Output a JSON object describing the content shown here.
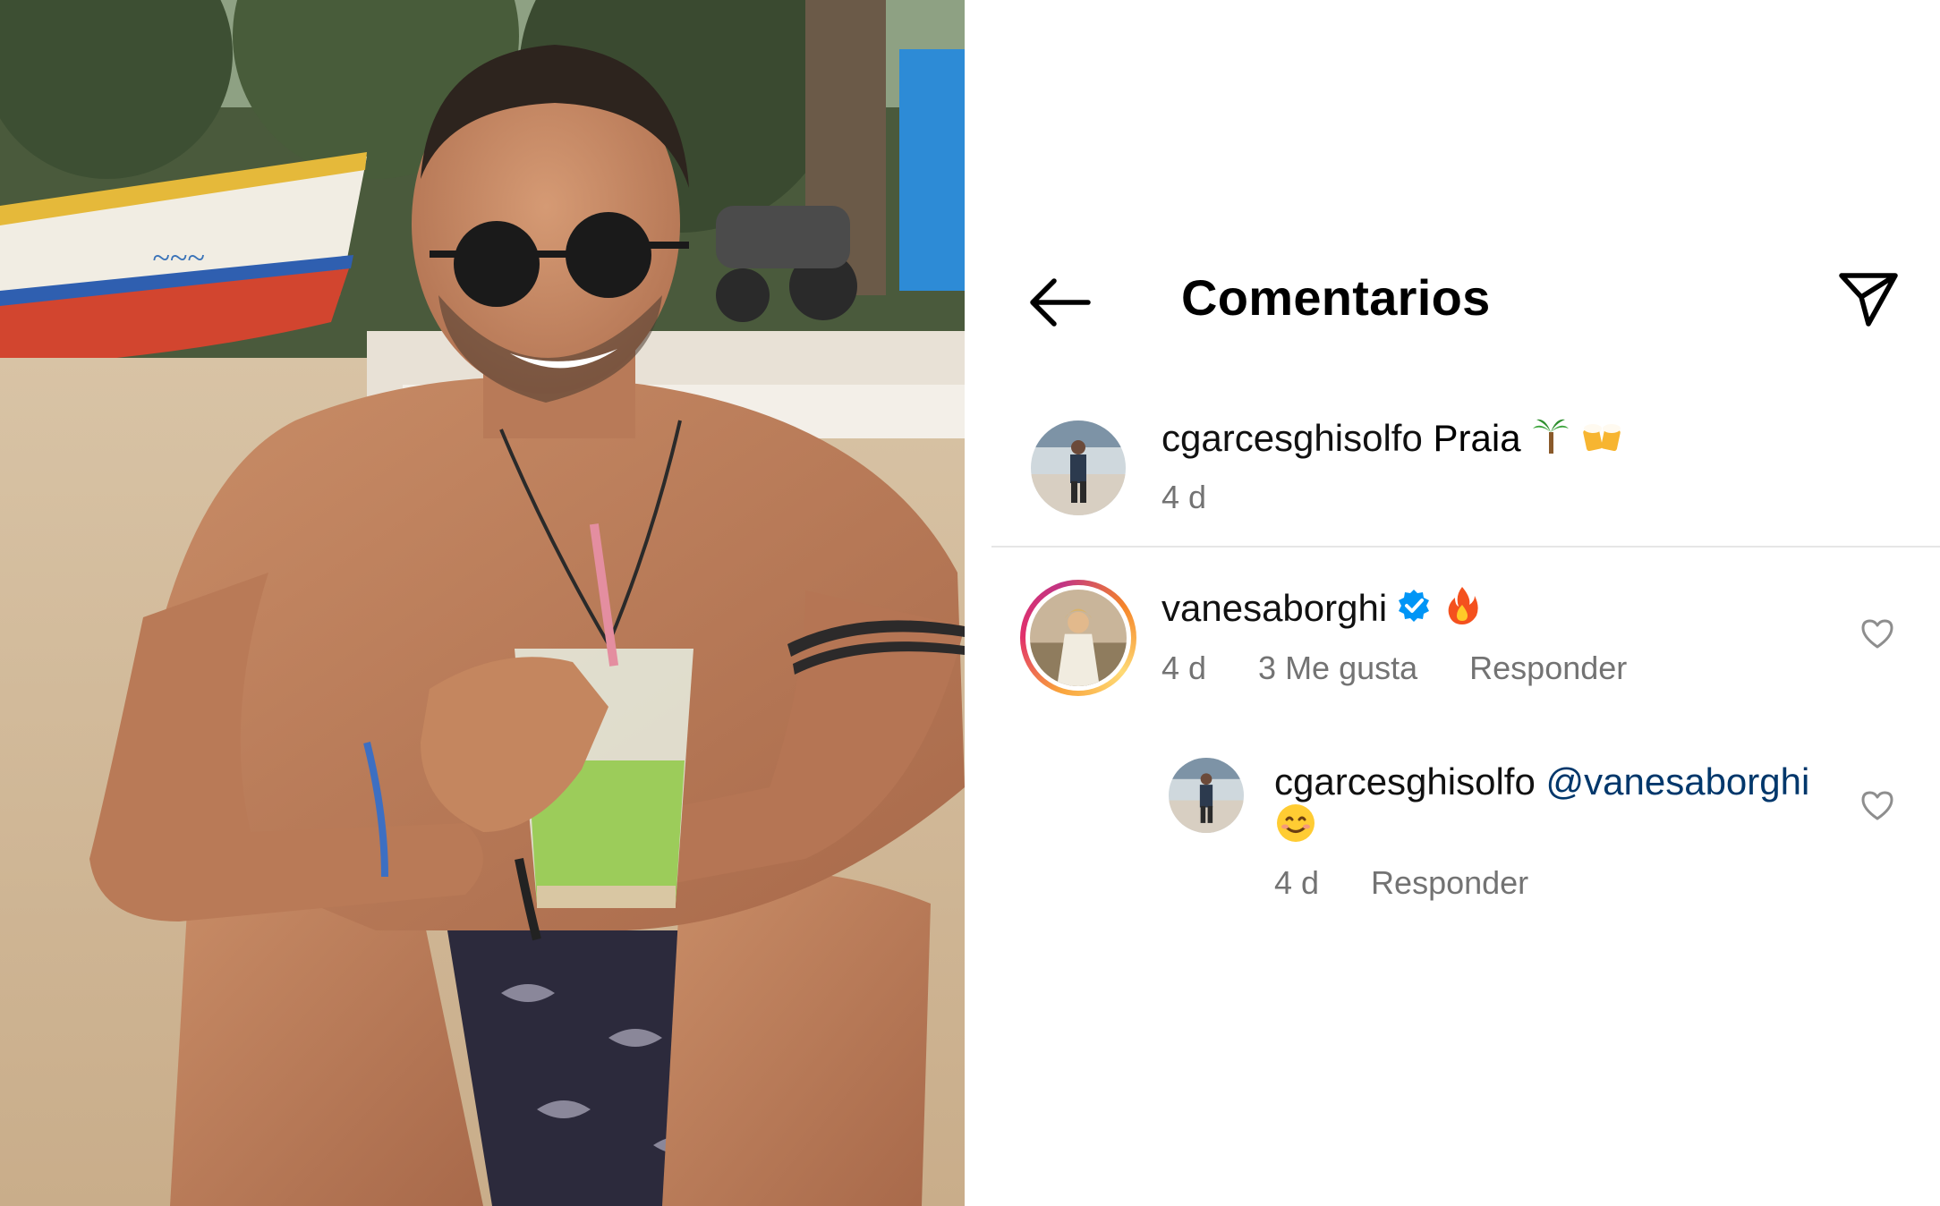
{
  "header": {
    "title": "Comentarios",
    "back_icon": "arrow-left-icon",
    "share_icon": "paper-plane-icon"
  },
  "caption": {
    "username": "cgarcesghisolfo",
    "text": "Praia",
    "emojis": [
      "palm-tree-emoji",
      "beer-mugs-emoji"
    ],
    "time": "4 d"
  },
  "comments": [
    {
      "username": "vanesaborghi",
      "verified": true,
      "emojis": [
        "fire-emoji"
      ],
      "time": "4 d",
      "likes": "3 Me gusta",
      "reply_label": "Responder",
      "has_story_ring": true,
      "replies": [
        {
          "username": "cgarcesghisolfo",
          "mention": "@vanesaborghi",
          "emojis": [
            "smiling-face-emoji"
          ],
          "time": "4 d",
          "reply_label": "Responder"
        }
      ]
    }
  ],
  "colors": {
    "mention": "#00376b",
    "secondary_text": "#737373",
    "verified_badge": "#0095f6",
    "divider": "#e6e6e6"
  }
}
